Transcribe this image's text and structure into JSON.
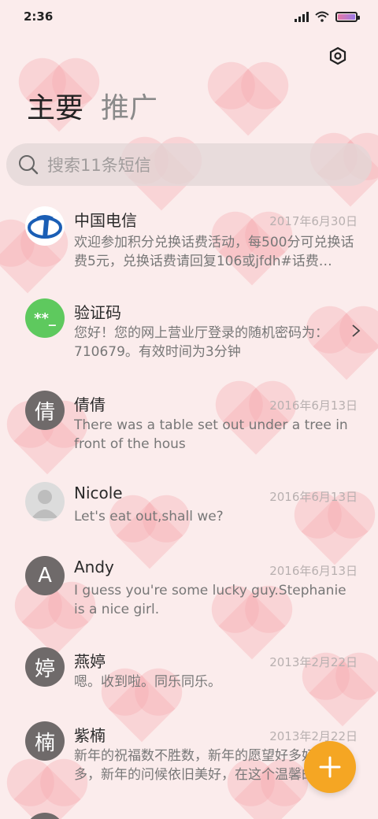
{
  "status_bar": {
    "time": "2:36"
  },
  "tabs": {
    "main": "主要",
    "promo": "推广"
  },
  "search": {
    "placeholder": "搜索11条短信"
  },
  "conversations": [
    {
      "name": "中国电信",
      "date": "2017年6月30日",
      "preview": "欢迎参加积分兑换话费活动，每500分可兑换话费5元，兑换话费请回复106或jfdh#话费…",
      "avatar_type": "logo"
    },
    {
      "name": "验证码",
      "date": "",
      "preview": "您好！您的网上营业厅登录的随机密码为：710679。有效时间为3分钟",
      "avatar_text": "**_",
      "avatar_type": "green"
    },
    {
      "name": "倩倩",
      "date": "2016年6月13日",
      "preview": "There was a table set out under a tree in front of the hous",
      "avatar_text": "倩",
      "avatar_type": "gray"
    },
    {
      "name": "Nicole",
      "date": "2016年6月13日",
      "preview": "Let's eat out,shall we?",
      "avatar_type": "person"
    },
    {
      "name": "Andy",
      "date": "2016年6月13日",
      "preview": "I guess you're some lucky guy.Stephanie is a nice girl.",
      "avatar_text": "A",
      "avatar_type": "gray"
    },
    {
      "name": "燕婷",
      "date": "2013年2月22日",
      "preview": "嗯。收到啦。同乐同乐。",
      "avatar_text": "婷",
      "avatar_type": "gray"
    },
    {
      "name": "紫楠",
      "date": "2013年2月22日",
      "preview": "新年的祝福数不胜数，新年的愿望好多好多，新年的问候依旧美好，在这个温馨的时刻",
      "avatar_text": "楠",
      "avatar_type": "gray"
    }
  ],
  "colors": {
    "fab": "#f5a623",
    "background": "#fbecec",
    "avatar_gray": "#6f6a6a",
    "avatar_green": "#5ec95e"
  },
  "icons": [
    "settings-icon",
    "search-icon",
    "chevron-right-icon",
    "plus-icon",
    "signal-icon",
    "wifi-icon",
    "battery-icon"
  ]
}
